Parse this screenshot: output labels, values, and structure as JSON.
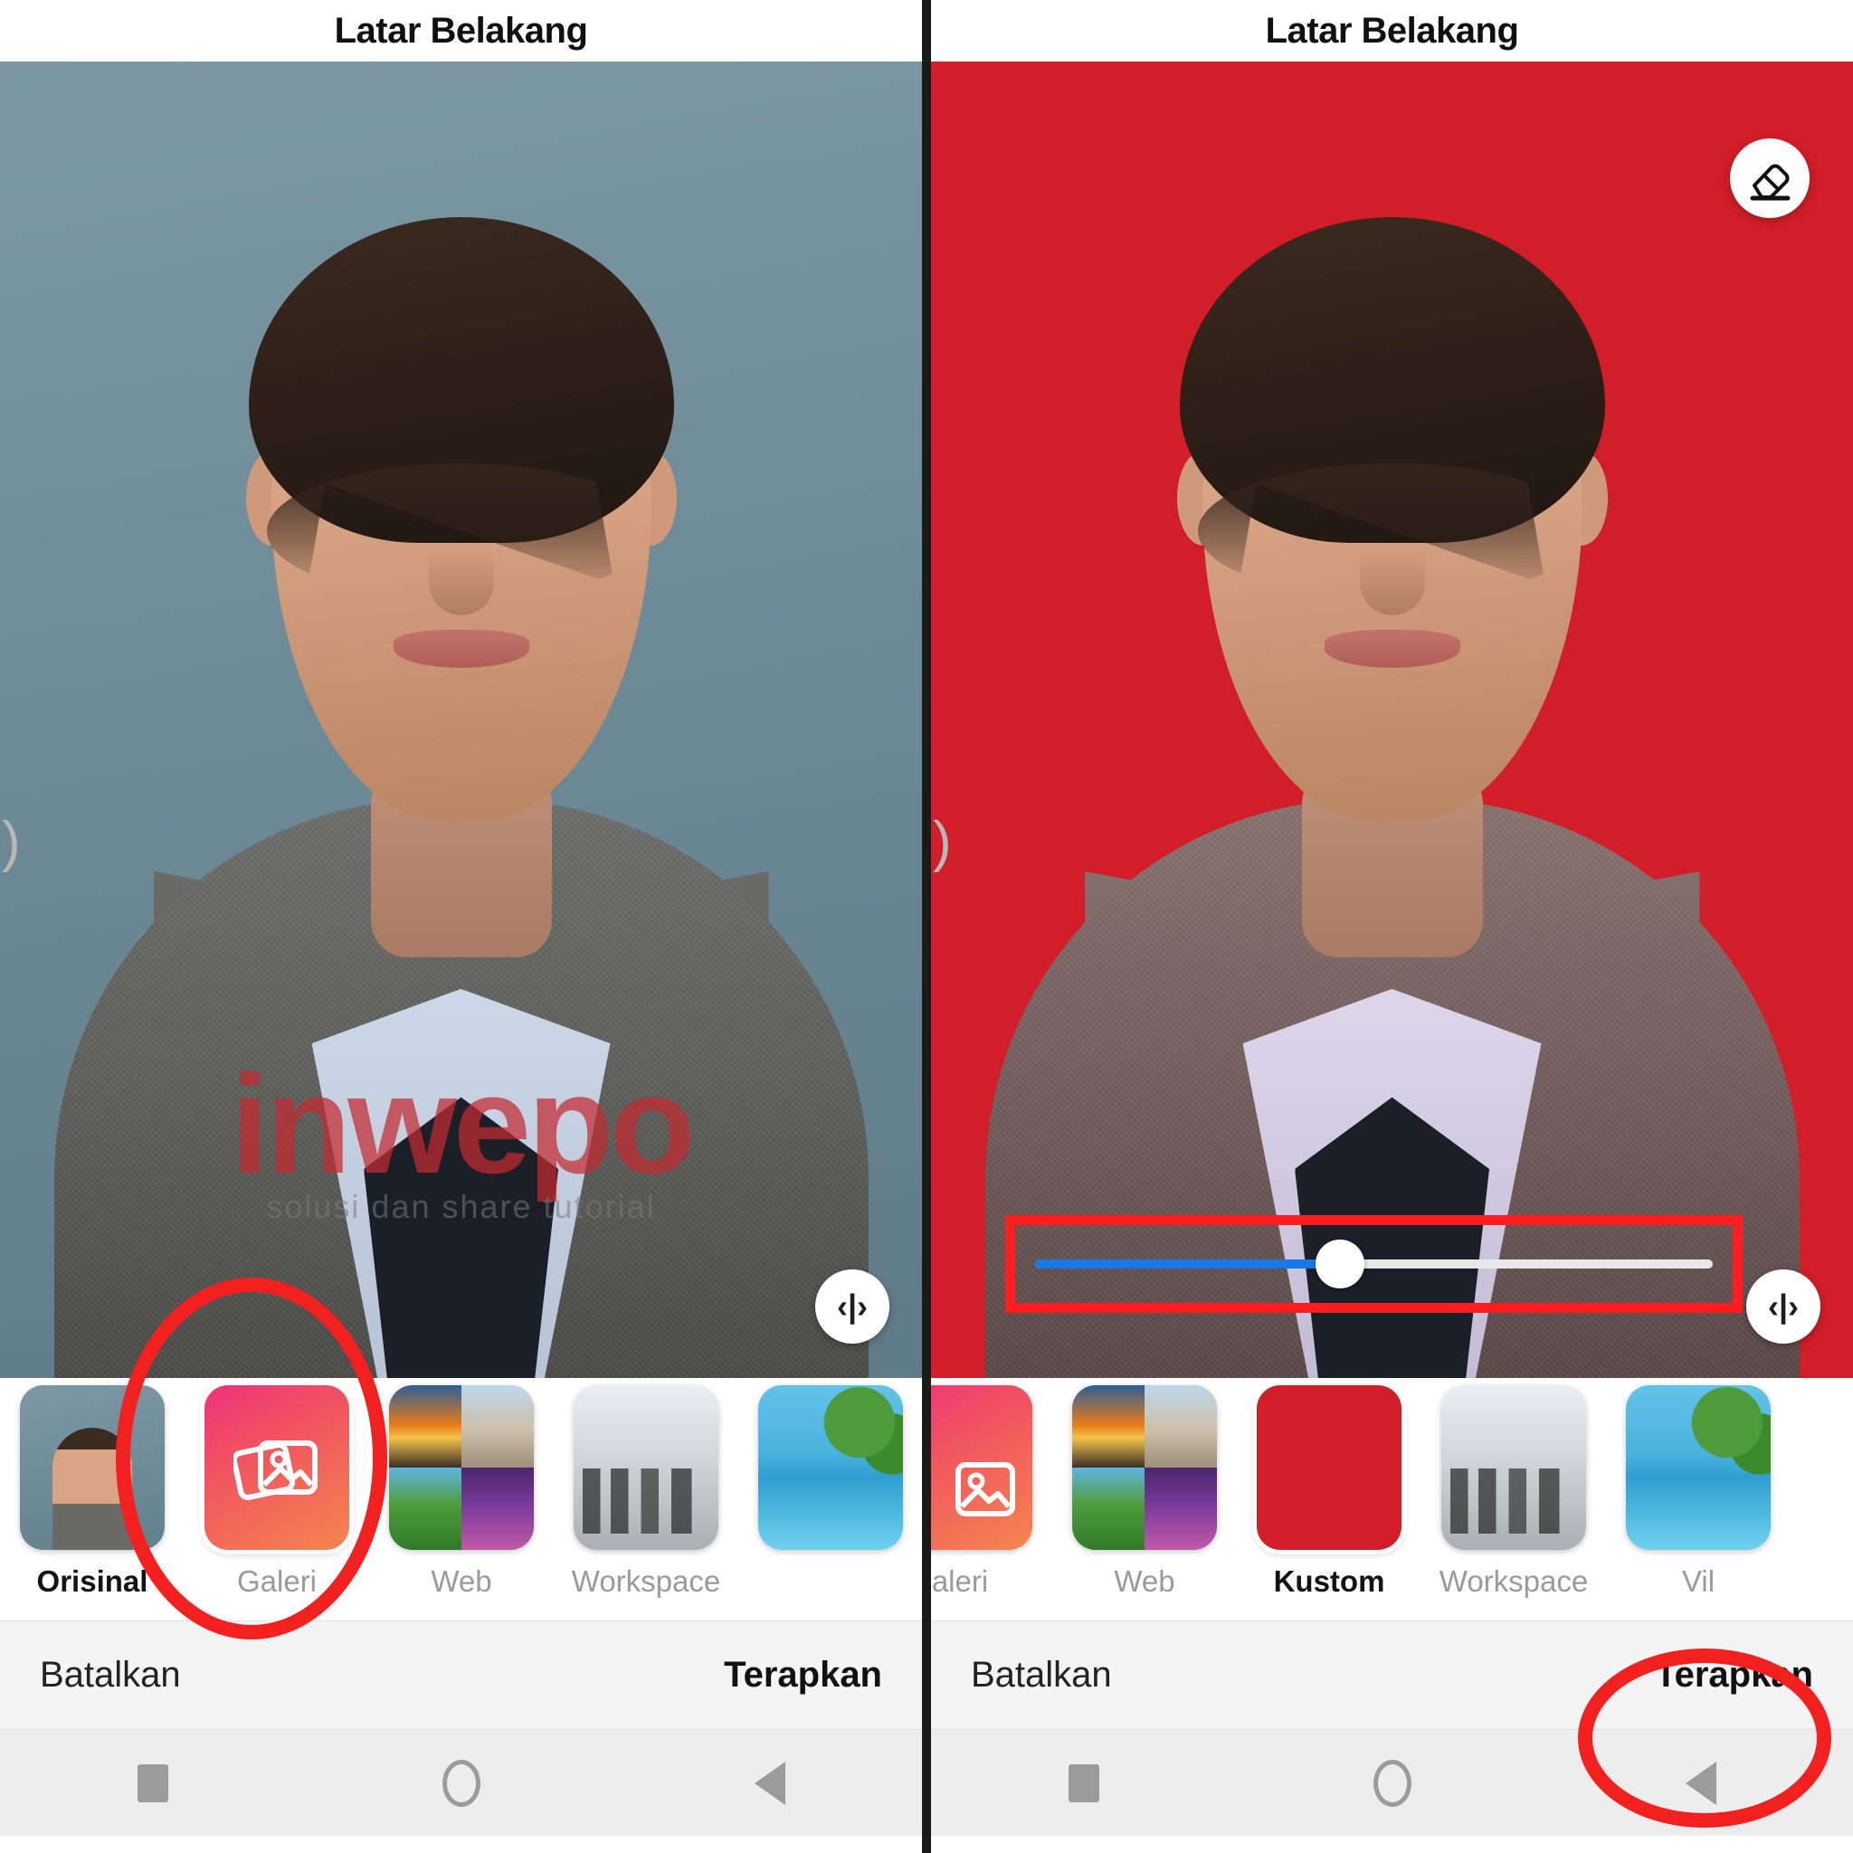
{
  "app": {
    "title": "Latar Belakang"
  },
  "panels": [
    {
      "id": "left",
      "title": "Latar Belakang",
      "background_mode": "original",
      "background_color": "#75929E",
      "watermark": {
        "main": "inwepo",
        "sub": "solusi dan share tutorial"
      },
      "overlay_controls": {
        "compare_icon": "compare-split-icon",
        "compare_glyph": "‹|›",
        "eraser_visible": false,
        "slider_visible": false
      },
      "thumbnails": [
        {
          "label": "Orisinal",
          "icon": "portrait-thumbnail",
          "selected": true,
          "style": "tn-orisinal"
        },
        {
          "label": "Galeri",
          "icon": "gallery-icon",
          "selected": false,
          "style": "tn-galeri"
        },
        {
          "label": "Web",
          "icon": "web-grid-thumbnail",
          "selected": false,
          "style": "tn-web"
        },
        {
          "label": "Workspace",
          "icon": "workspace-thumbnail",
          "selected": false,
          "style": "tn-workspace"
        }
      ],
      "actions": {
        "cancel": "Batalkan",
        "apply": "Terapkan"
      },
      "annotation": {
        "type": "ellipse",
        "target": "Galeri",
        "color": "#F32020"
      }
    },
    {
      "id": "right",
      "title": "Latar Belakang",
      "background_mode": "custom",
      "background_color": "#D21E28",
      "watermark": {
        "main": "",
        "sub": ""
      },
      "overlay_controls": {
        "compare_icon": "compare-split-icon",
        "compare_glyph": "‹|›",
        "eraser_visible": true,
        "eraser_icon": "eraser-icon",
        "slider_visible": true,
        "slider": {
          "value_percent": 45,
          "fill_color": "#1779E8",
          "track_color": "#E8E8E8",
          "thumb_color": "#FFFFFF",
          "highlight_color": "#FF1D21"
        }
      },
      "thumbnails": [
        {
          "label": "aleri",
          "icon": "gallery-icon",
          "selected": false,
          "style": "tn-galeri"
        },
        {
          "label": "Web",
          "icon": "web-grid-thumbnail",
          "selected": false,
          "style": "tn-web"
        },
        {
          "label": "Kustom",
          "icon": "solid-red-swatch",
          "selected": true,
          "style": "tn-kustom"
        },
        {
          "label": "Workspace",
          "icon": "workspace-thumbnail",
          "selected": false,
          "style": "tn-workspace"
        },
        {
          "label": "Vil",
          "icon": "villa-thumbnail",
          "selected": false,
          "style": "tn-villa"
        }
      ],
      "actions": {
        "cancel": "Batalkan",
        "apply": "Terapkan"
      },
      "annotation": {
        "type": "ellipse",
        "target": "Terapkan",
        "color": "#F32020"
      }
    }
  ],
  "navbar": {
    "recents_label": "recents-square-icon",
    "home_label": "home-circle-icon",
    "back_label": "back-triangle-icon"
  },
  "edge_glyphs": {
    "left": ")",
    "right": ")"
  }
}
